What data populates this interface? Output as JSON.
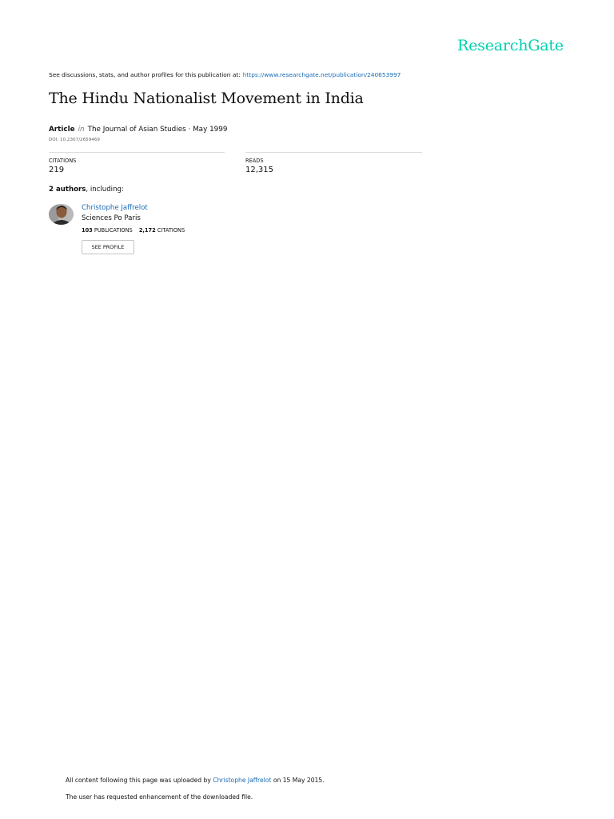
{
  "brand": {
    "logo_text": "ResearchGate",
    "color": "#00d0af",
    "link_color": "#1a6cb5"
  },
  "intro": {
    "text": "See discussions, stats, and author profiles for this publication at:",
    "url": "https://www.researchgate.net/publication/240653997"
  },
  "title": "The Hindu Nationalist Movement in India",
  "meta": {
    "type": "Article",
    "in": "in",
    "journal": "The Journal of Asian Studies · May 1999",
    "doi": "DOI: 10.2307/2659469"
  },
  "stats": {
    "citations_label": "CITATIONS",
    "citations_value": "219",
    "reads_label": "READS",
    "reads_value": "12,315"
  },
  "authors": {
    "count_label": "2 authors",
    "suffix": ", including:",
    "items": [
      {
        "name": "Christophe Jaffrelot",
        "affiliation": "Sciences Po Paris",
        "publications_count": "103",
        "publications_label": "PUBLICATIONS",
        "citations_count": "2,172",
        "citations_label": "CITATIONS",
        "button_label": "SEE PROFILE",
        "avatar_icon": "author-photo"
      }
    ]
  },
  "footer": {
    "upload_prefix": "All content following this page was uploaded by",
    "upload_author": "Christophe Jaffrelot",
    "upload_suffix": "on 15 May 2015.",
    "note": "The user has requested enhancement of the downloaded file."
  }
}
